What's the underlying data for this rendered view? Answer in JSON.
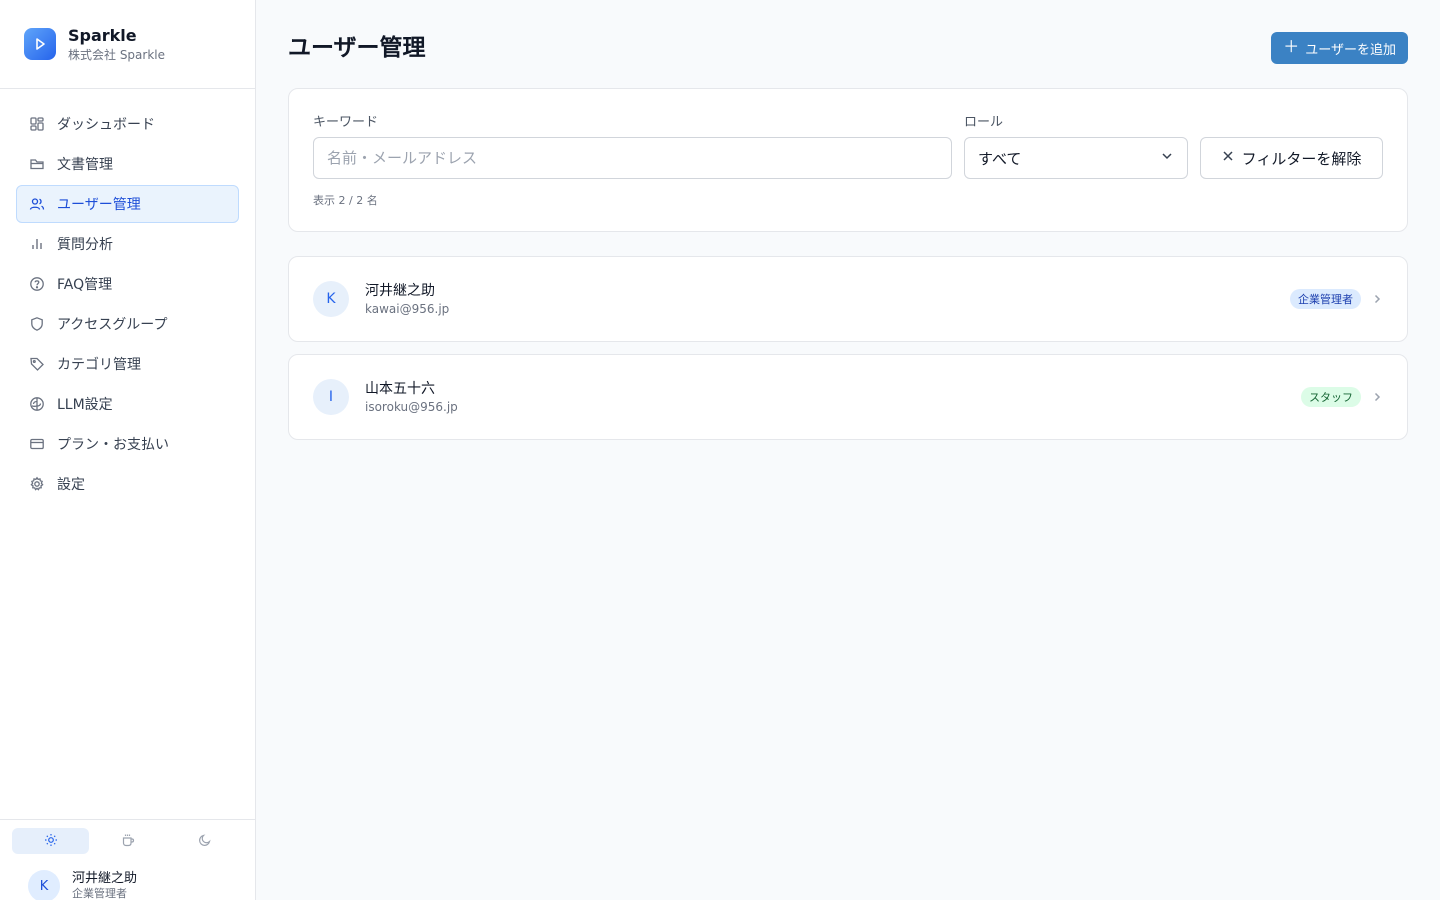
{
  "brand": {
    "name": "Sparkle",
    "org": "株式会社 Sparkle",
    "accent": "#2563eb"
  },
  "nav": {
    "items": [
      {
        "label": "ダッシュボード",
        "icon": "grid-icon"
      },
      {
        "label": "文書管理",
        "icon": "folder-icon"
      },
      {
        "label": "ユーザー管理",
        "icon": "users-icon",
        "active": true
      },
      {
        "label": "質問分析",
        "icon": "bar-chart-icon"
      },
      {
        "label": "FAQ管理",
        "icon": "help-circle-icon"
      },
      {
        "label": "アクセスグループ",
        "icon": "shield-icon"
      },
      {
        "label": "カテゴリ管理",
        "icon": "tag-icon"
      },
      {
        "label": "LLM設定",
        "icon": "brain-icon"
      },
      {
        "label": "プラン・お支払い",
        "icon": "credit-card-icon"
      },
      {
        "label": "設定",
        "icon": "gear-icon"
      }
    ]
  },
  "theme": {
    "options": [
      "light",
      "warm",
      "dark"
    ],
    "selected": "light"
  },
  "current_user": {
    "initial": "K",
    "name": "河井継之助",
    "role": "企業管理者"
  },
  "page": {
    "title": "ユーザー管理",
    "add_button": "ユーザーを追加"
  },
  "filters": {
    "keyword_label": "キーワード",
    "keyword_placeholder": "名前・メールアドレス",
    "keyword_value": "",
    "role_label": "ロール",
    "role_value": "すべて",
    "clear_button": "フィルターを解除",
    "count_text": "表示 2 / 2 名"
  },
  "users": [
    {
      "initial": "K",
      "name": "河井継之助",
      "email": "kawai@956.jp",
      "role": "企業管理者",
      "role_type": "admin"
    },
    {
      "initial": "I",
      "name": "山本五十六",
      "email": "isoroku@956.jp",
      "role": "スタッフ",
      "role_type": "staff"
    }
  ]
}
